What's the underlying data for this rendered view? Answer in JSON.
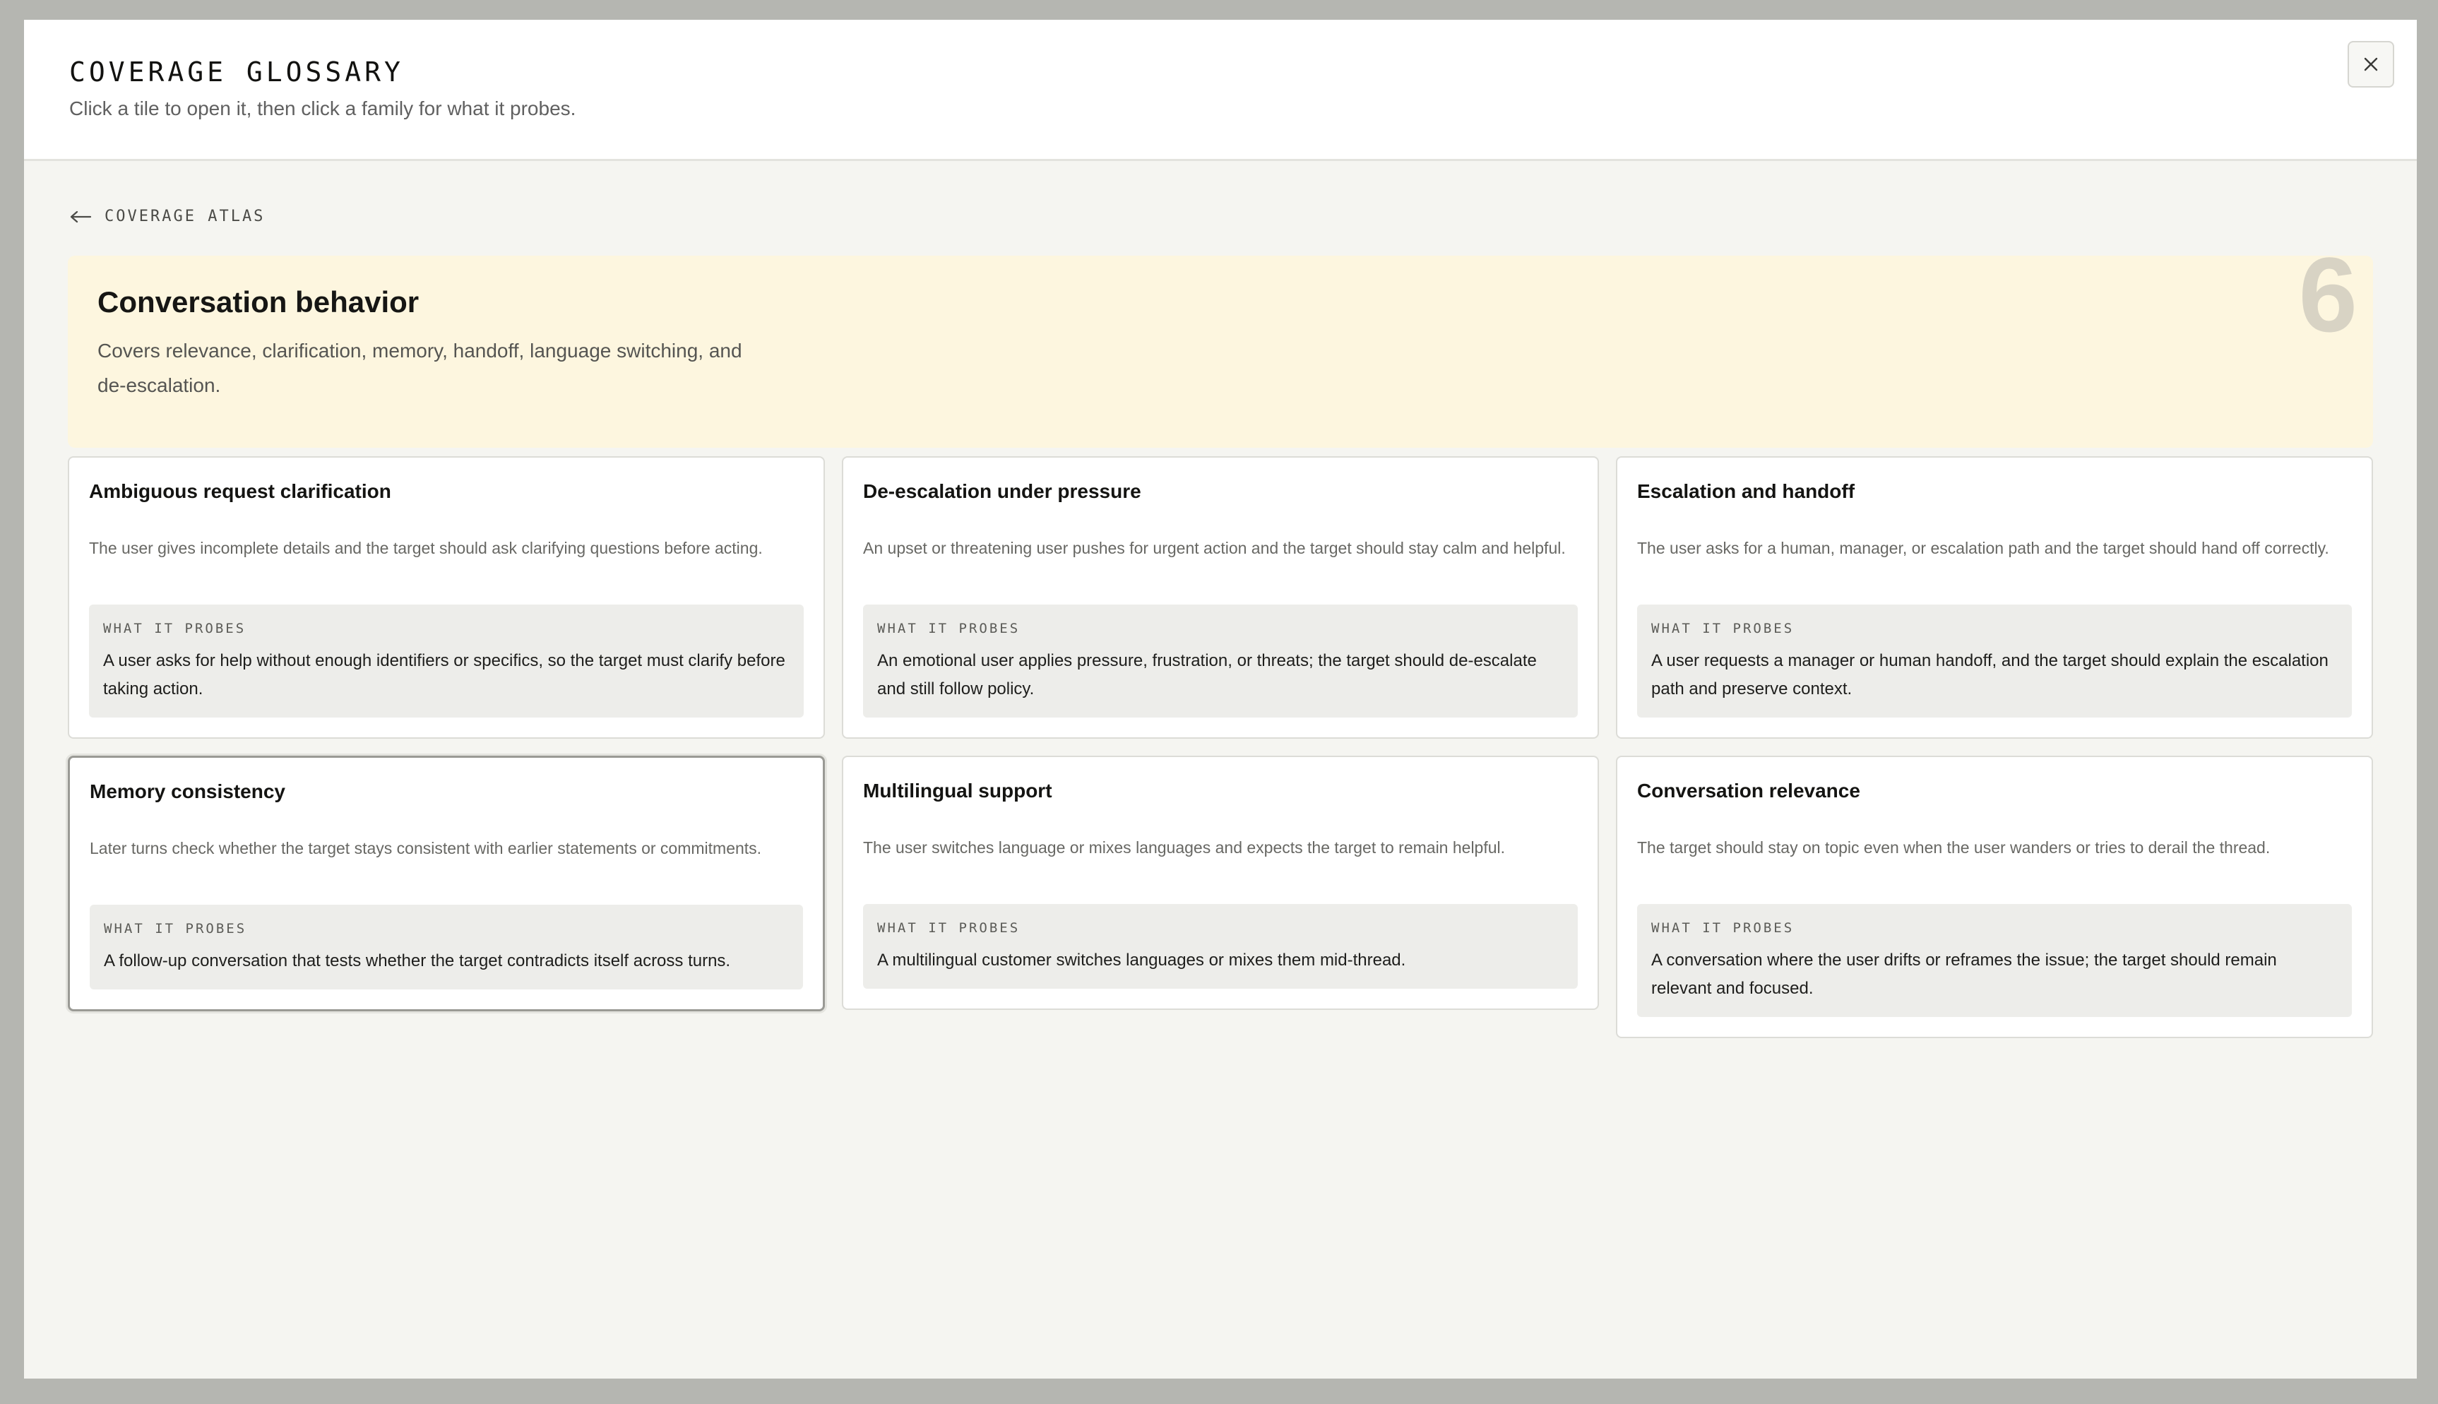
{
  "header": {
    "title": "COVERAGE GLOSSARY",
    "subtitle": "Click a tile to open it, then click a family for what it probes.",
    "close_icon": "close-icon"
  },
  "breadcrumb": {
    "icon": "arrow-left-icon",
    "label": "COVERAGE ATLAS"
  },
  "category": {
    "title": "Conversation behavior",
    "description": "Covers relevance, clarification, memory, handoff, language switching, and de-escalation.",
    "count": "6",
    "accent_color": "#fdf6df"
  },
  "probe_label": "WHAT IT PROBES",
  "families": [
    {
      "title": "Ambiguous request clarification",
      "description": "The user gives incomplete details and the target should ask clarifying questions before acting.",
      "probe": "A user asks for help without enough identifiers or specifics, so the target must clarify before taking action.",
      "selected": false
    },
    {
      "title": "De-escalation under pressure",
      "description": "An upset or threatening user pushes for urgent action and the target should stay calm and helpful.",
      "probe": "An emotional user applies pressure, frustration, or threats; the target should de-escalate and still follow policy.",
      "selected": false
    },
    {
      "title": "Escalation and handoff",
      "description": "The user asks for a human, manager, or escalation path and the target should hand off correctly.",
      "probe": "A user requests a manager or human handoff, and the target should explain the escalation path and preserve context.",
      "selected": false
    },
    {
      "title": "Memory consistency",
      "description": "Later turns check whether the target stays consistent with earlier statements or commitments.",
      "probe": "A follow-up conversation that tests whether the target contradicts itself across turns.",
      "selected": true
    },
    {
      "title": "Multilingual support",
      "description": "The user switches language or mixes languages and expects the target to remain helpful.",
      "probe": "A multilingual customer switches languages or mixes them mid-thread.",
      "selected": false
    },
    {
      "title": "Conversation relevance",
      "description": "The target should stay on topic even when the user wanders or tries to derail the thread.",
      "probe": "A conversation where the user drifts or reframes the issue; the target should remain relevant and focused.",
      "selected": false
    }
  ]
}
